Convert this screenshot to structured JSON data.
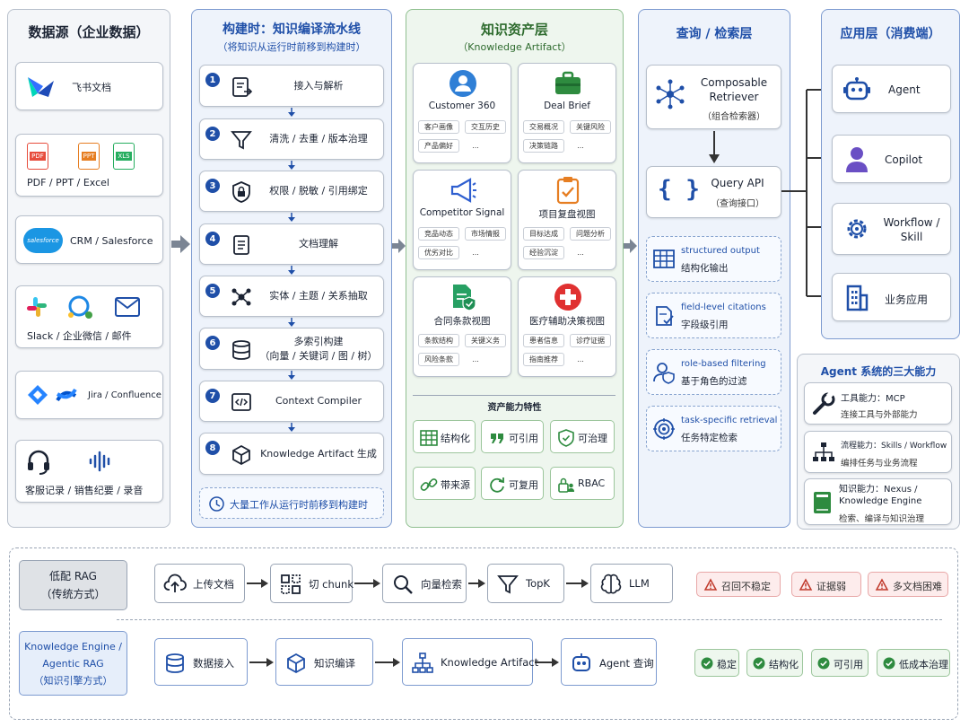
{
  "sources": {
    "title": "数据源（企业数据）",
    "items": [
      "飞书文档",
      "PDF / PPT / Excel",
      "CRM / Salesforce",
      "Slack / 企业微信 / 邮件",
      "Jira / Confluence",
      "客服记录 / 销售纪要 / 录音"
    ],
    "file_badges": [
      "PDF",
      "PPT",
      "XLS"
    ],
    "sf_logo": "salesforce"
  },
  "pipeline": {
    "title": "构建时：知识编译流水线",
    "subtitle": "（将知识从运行时前移到构建时）",
    "steps": [
      {
        "n": "1",
        "label": "接入与解析"
      },
      {
        "n": "2",
        "label": "清洗 / 去重 / 版本治理"
      },
      {
        "n": "3",
        "label": "权限 / 脱敏 / 引用绑定"
      },
      {
        "n": "4",
        "label": "文档理解"
      },
      {
        "n": "5",
        "label": "实体 / 主题 / 关系抽取"
      },
      {
        "n": "6",
        "label": "多索引构建\n（向量 / 关键词 / 图 / 树）"
      },
      {
        "n": "7",
        "label": "Context Compiler"
      },
      {
        "n": "8",
        "label": "Knowledge Artifact 生成"
      }
    ],
    "footer": "大量工作从运行时前移到构建时"
  },
  "assets": {
    "title": "知识资产层",
    "subtitle": "（Knowledge Artifact）",
    "cards": [
      {
        "name": "Customer 360",
        "tags": [
          "客户画像",
          "交互历史",
          "产品偏好",
          "..."
        ]
      },
      {
        "name": "Deal Brief",
        "tags": [
          "交易概况",
          "关键风险",
          "决策链路",
          "..."
        ]
      },
      {
        "name": "Competitor Signal",
        "tags": [
          "竞品动态",
          "市场情报",
          "优劣对比",
          "..."
        ]
      },
      {
        "name": "项目复盘视图",
        "tags": [
          "目标达成",
          "问题分析",
          "经验沉淀",
          "..."
        ]
      },
      {
        "name": "合同条款视图",
        "tags": [
          "条款结构",
          "关键义务",
          "风险条款",
          "..."
        ]
      },
      {
        "name": "医疗辅助决策视图",
        "tags": [
          "患者信息",
          "诊疗证据",
          "指南推荐",
          "..."
        ]
      }
    ],
    "features_title": "资产能力特性",
    "features": [
      "结构化",
      "可引用",
      "可治理",
      "带来源",
      "可复用",
      "RBAC"
    ]
  },
  "query": {
    "title": "查询 / 检索层",
    "retriever": {
      "name": "Composable\nRetriever",
      "sub": "（组合检索器）"
    },
    "api": {
      "name": "Query API",
      "sub": "（查询接口）"
    },
    "items": [
      {
        "en": "structured output",
        "zh": "结构化输出"
      },
      {
        "en": "field-level citations",
        "zh": "字段级引用"
      },
      {
        "en": "role-based filtering",
        "zh": "基于角色的过滤"
      },
      {
        "en": "task-specific retrieval",
        "zh": "任务特定检索"
      }
    ]
  },
  "apps": {
    "title": "应用层（消费端）",
    "items": [
      "Agent",
      "Copilot",
      "Workflow /\nSkill",
      "业务应用"
    ],
    "caps_title": "Agent 系统的三大能力",
    "caps": [
      {
        "t": "工具能力：MCP",
        "d": "连接工具与外部能力"
      },
      {
        "t": "流程能力：Skills / Workflow",
        "d": "编排任务与业务流程"
      },
      {
        "t": "知识能力：Nexus /\nKnowledge Engine",
        "d": "检索、编译与知识治理"
      }
    ]
  },
  "compare": {
    "low": {
      "label": "低配 RAG\n（传统方式）",
      "steps": [
        "上传文档",
        "切 chunk",
        "向量检索",
        "TopK",
        "LLM"
      ],
      "issues": [
        "召回不稳定",
        "证据弱",
        "多文档困难"
      ]
    },
    "high": {
      "label": "Knowledge Engine /\nAgentic RAG\n（知识引擎方式）",
      "steps": [
        "数据接入",
        "知识编译",
        "Knowledge Artifact",
        "Agent 查询"
      ],
      "benefits": [
        "稳定",
        "结构化",
        "可引用",
        "低成本治理"
      ]
    }
  },
  "colors": {
    "navy": "#1f4fa8",
    "blue_col": "#eef3fb",
    "green_col": "#eef6ee",
    "green": "#2e8b3f",
    "red": "#c0392b",
    "orange": "#e67e22"
  }
}
